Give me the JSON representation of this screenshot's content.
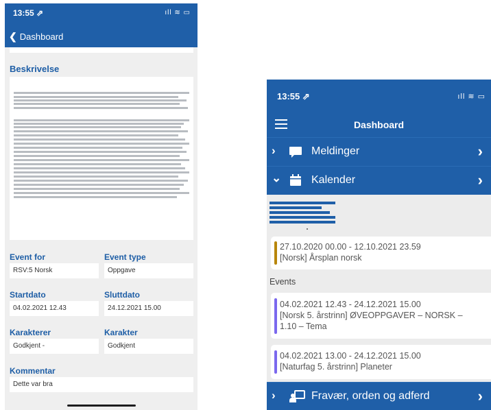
{
  "left_screen": {
    "status_time": "13:55 ⇗",
    "status_icons": "ıll ≋ ▭",
    "back_label": "Dashboard",
    "description_heading": "Beskrivelse",
    "fields": {
      "event_for_label": "Event for",
      "event_for_value": "RSV:5 Norsk",
      "event_type_label": "Event type",
      "event_type_value": "Oppgave",
      "start_label": "Startdato",
      "start_value": "04.02.2021 12.43",
      "end_label": "Sluttdato",
      "end_value": "24.12.2021 15.00",
      "grades_label": "Karakterer",
      "grades_value": "Godkjent -",
      "grade_label": "Karakter",
      "grade_value": "Godkjent",
      "comment_label": "Kommentar",
      "comment_value": "Dette var bra"
    }
  },
  "right_screen": {
    "status_time": "13:55 ⇗",
    "status_icons": "ıll ≋ ▭",
    "title": "Dashboard",
    "sections": {
      "messages_label": "Meldinger",
      "calendar_label": "Kalender",
      "absence_label": "Fravær, orden og adferd"
    },
    "schedule_item": {
      "date_range": "27.10.2020 00.00 - 12.10.2021 23.59",
      "title": "[Norsk] Årsplan norsk",
      "stripe_color": "#b8860b"
    },
    "events_heading": "Events",
    "events": [
      {
        "date_range": "04.02.2021 12.43 - 24.12.2021 15.00",
        "title_line1": "[Norsk 5. årstrinn] ØVEOPPGAVER – NORSK –",
        "title_line2": "1.10 – Tema",
        "stripe_color": "#7b68ee"
      },
      {
        "date_range": "04.02.2021 13.00 - 24.12.2021 15.00",
        "title_line1": "[Naturfag 5. årstrinn] Planeter",
        "stripe_color": "#7b68ee"
      }
    ]
  },
  "colors": {
    "brand_blue": "#1f5fa8",
    "label_blue": "#1e5ea6",
    "background": "#efefef"
  }
}
